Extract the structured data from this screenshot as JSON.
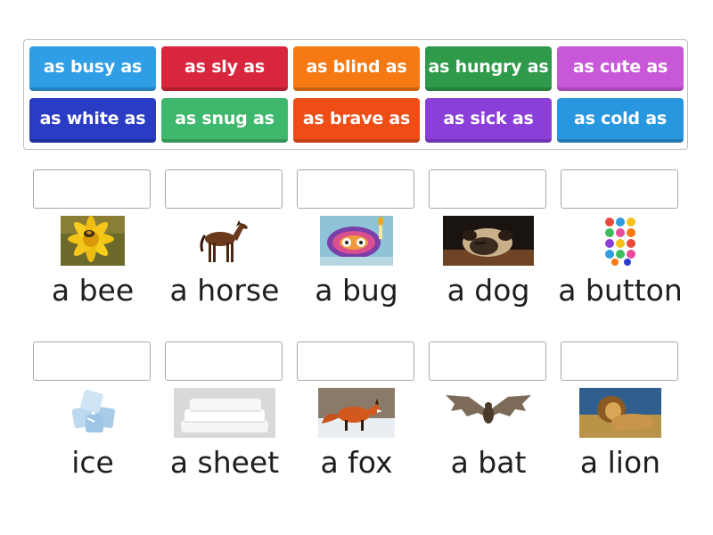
{
  "tiles": [
    {
      "label": "as busy as",
      "color": "#2f9ee6"
    },
    {
      "label": "as sly as",
      "color": "#d9263f"
    },
    {
      "label": "as blind as",
      "color": "#f57a14"
    },
    {
      "label": "as hungry as",
      "color": "#2e9a4a"
    },
    {
      "label": "as cute as",
      "color": "#c958d9"
    },
    {
      "label": "as white as",
      "color": "#2b3cc4"
    },
    {
      "label": "as snug as",
      "color": "#3db86c"
    },
    {
      "label": "as brave as",
      "color": "#ee4d16"
    },
    {
      "label": "as sick as",
      "color": "#8b3fd9"
    },
    {
      "label": "as cold as",
      "color": "#2997e0"
    }
  ],
  "items": [
    {
      "label": "a bee",
      "image": "bee-on-yellow-flower"
    },
    {
      "label": "a horse",
      "image": "brown-horse"
    },
    {
      "label": "a bug",
      "image": "bug-in-rug-illustration"
    },
    {
      "label": "a dog",
      "image": "sleeping-pug"
    },
    {
      "label": "a button",
      "image": "colorful-buttons"
    },
    {
      "label": "ice",
      "image": "ice-cubes"
    },
    {
      "label": "a sheet",
      "image": "folded-white-sheets"
    },
    {
      "label": "a fox",
      "image": "red-fox-in-snow"
    },
    {
      "label": "a bat",
      "image": "flying-bat"
    },
    {
      "label": "a lion",
      "image": "lion-in-grass"
    }
  ]
}
